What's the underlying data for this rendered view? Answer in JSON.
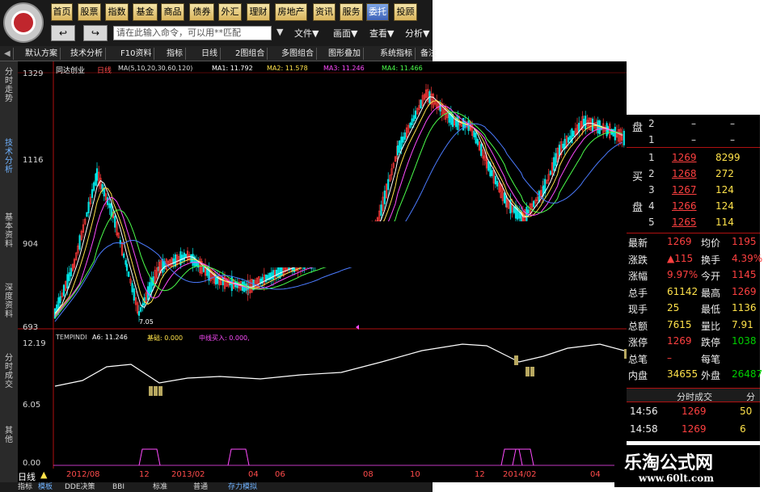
{
  "colors": {
    "up": "#ff3a3a",
    "down": "#00d000",
    "neutral": "#ffffff",
    "axis": "#b01010",
    "highlight_blue": "#5f8fff"
  },
  "menu": {
    "items": [
      "首页",
      "股票",
      "指数",
      "基金",
      "商品",
      "债券",
      "外汇",
      "理财",
      "房地产",
      "资讯",
      "服务",
      "委托",
      "投顾"
    ],
    "back_icon": "back-arrow-icon",
    "forward_icon": "forward-arrow-icon",
    "command_placeholder": "请在此输入命令，可以用**匹配",
    "file": "文件▼",
    "view": "画面▼",
    "lookup": "查看▼",
    "analysis": "分析▼"
  },
  "toolbar": {
    "items": [
      "默认方案",
      "技术分析",
      "F10资料",
      "指标",
      "日线",
      "2图组合",
      "多图组合",
      "图形叠加",
      "系统指标",
      "备注"
    ]
  },
  "sidebar": {
    "tabs": [
      "分时走势",
      "技术分析",
      "基本资料",
      "深度资料",
      "分时成交",
      "其他"
    ],
    "active": 1
  },
  "stock": {
    "name": "同达创业",
    "period": "日线",
    "ma_label": "MA(5,10,20,30,60,120)",
    "ma1": "MA1: 11.792",
    "ma2": "MA2: 11.578",
    "ma3": "MA3: 11.246",
    "ma4": "MA4: 11.466"
  },
  "price_axis": {
    "top": "1329",
    "l1": "1116",
    "l2": "904",
    "bottom": "693"
  },
  "price_min_note": "7.05",
  "indicator": {
    "name": "TEMPINDI",
    "a6": "A6: 11.246",
    "jichu": "基础: 0.000",
    "zhongxian": "中线买入: 0.000,",
    "axis_top": "12.19",
    "axis_mid": "6.05",
    "axis_bottom": "0.00"
  },
  "x_axis": {
    "labels": [
      "2012/08",
      "12",
      "2013/02",
      "04",
      "06",
      "08",
      "10",
      "12",
      "2014/02",
      "04"
    ],
    "period_label": "日线"
  },
  "bottom_tabs": {
    "items": [
      "指标",
      "模板",
      "DDE决策",
      "BBI",
      "标准",
      "普通",
      "存力模拟"
    ],
    "active_index": 1
  },
  "orderbook": {
    "sell_label": "盘",
    "buy_label_1": "买",
    "buy_label_2": "盘",
    "sell_rows": [
      {
        "lvl": "2",
        "price": "–",
        "vol": "–"
      },
      {
        "lvl": "1",
        "price": "–",
        "vol": "–"
      }
    ],
    "buy_rows": [
      {
        "lvl": "1",
        "price": "1269",
        "vol": "8299"
      },
      {
        "lvl": "2",
        "price": "1268",
        "vol": "272"
      },
      {
        "lvl": "3",
        "price": "1267",
        "vol": "124"
      },
      {
        "lvl": "4",
        "price": "1266",
        "vol": "124"
      },
      {
        "lvl": "5",
        "price": "1265",
        "vol": "114"
      }
    ]
  },
  "quote": {
    "rows": [
      {
        "l": "最新",
        "v": "1269",
        "l2": "均价",
        "v2": "1195"
      },
      {
        "l": "涨跌",
        "v": "▲115",
        "l2": "换手",
        "v2": "4.39%"
      },
      {
        "l": "涨幅",
        "v": "9.97%",
        "l2": "今开",
        "v2": "1145"
      },
      {
        "l": "总手",
        "v": "61142",
        "l2": "最高",
        "v2": "1269"
      },
      {
        "l": "现手",
        "v": "25",
        "l2": "最低",
        "v2": "1136"
      },
      {
        "l": "总额",
        "v": "7615",
        "l2": "量比",
        "v2": "7.91"
      },
      {
        "l": "涨停",
        "v": "1269",
        "l2": "跌停",
        "v2": "1038"
      },
      {
        "l": "总笔",
        "v": "–",
        "l2": "每笔",
        "v2": ""
      },
      {
        "l": "内盘",
        "v": "34655",
        "l2": "外盘",
        "v2": "26487"
      }
    ]
  },
  "trades": {
    "title": "分时成交",
    "tab2": "分",
    "rows": [
      {
        "t": "14:56",
        "p": "1269",
        "v": "50"
      },
      {
        "t": "14:58",
        "p": "1269",
        "v": "6"
      }
    ]
  },
  "watermark": {
    "title": "乐淘公式网",
    "url": "www.60lt.com"
  },
  "chart_data": {
    "type": "line",
    "price_axis_ticks": [
      1329,
      1116,
      904,
      693
    ],
    "indicator_axis_ticks": [
      12.19,
      6.05,
      0.0
    ]
  }
}
